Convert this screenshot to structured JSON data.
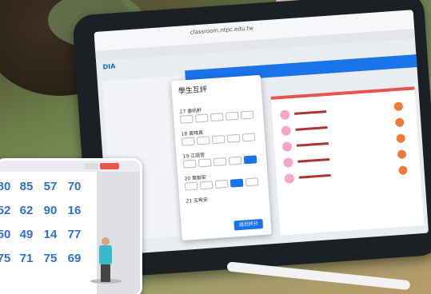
{
  "tablet": {
    "url": "classroom.ntpc.edu.tw",
    "logo": "DIA",
    "modal_title": "學生互評",
    "submit_label": "送出評分",
    "questions": [
      "17 康帆軒",
      "18 黃晴真",
      "19 江語萱",
      "20 葉郁安",
      "21 王宥安"
    ]
  },
  "inset": {
    "numbers": [
      [
        "80",
        "85",
        "57",
        "70"
      ],
      [
        "52",
        "62",
        "90",
        "16"
      ],
      [
        "50",
        "49",
        "14",
        "77"
      ],
      [
        "75",
        "71",
        "75",
        "69"
      ]
    ]
  }
}
